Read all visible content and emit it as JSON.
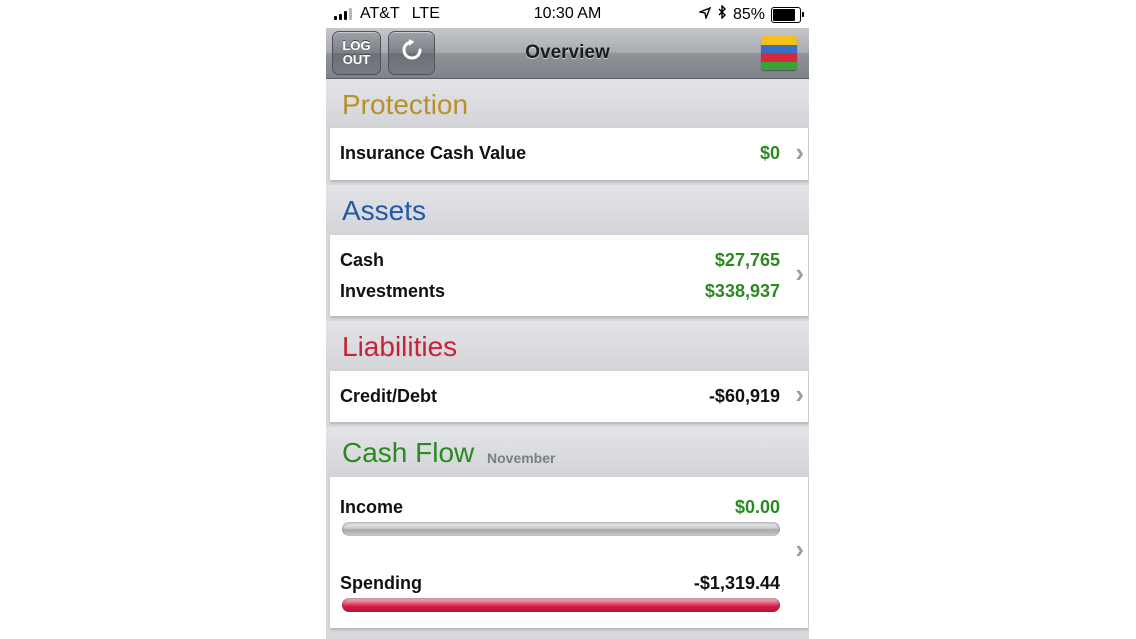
{
  "status_bar": {
    "carrier": "AT&T",
    "network": "LTE",
    "time": "10:30 AM",
    "battery_percent": "85%",
    "battery_level": 0.85
  },
  "nav": {
    "logout_label": "LOG\nOUT",
    "refresh_icon": "refresh-icon",
    "title": "Overview",
    "logo_icon": "app-logo-icon"
  },
  "colors": {
    "protection": "#b8902a",
    "assets": "#2358a6",
    "liabilities": "#c8213a",
    "cashflow": "#2a8a1f",
    "positive_value": "#2a8a1f",
    "spending_bar": "#d61c46"
  },
  "protection": {
    "title": "Protection",
    "rows": [
      {
        "label": "Insurance Cash Value",
        "value": "$0"
      }
    ]
  },
  "assets": {
    "title": "Assets",
    "rows": [
      {
        "label": "Cash",
        "value": "$27,765"
      },
      {
        "label": "Investments",
        "value": "$338,937"
      }
    ]
  },
  "liabilities": {
    "title": "Liabilities",
    "rows": [
      {
        "label": "Credit/Debt",
        "value": "-$60,919"
      }
    ]
  },
  "cashflow": {
    "title": "Cash Flow",
    "period": "November",
    "income": {
      "label": "Income",
      "value": "$0.00",
      "bar_fraction": 0.0
    },
    "spending": {
      "label": "Spending",
      "value": "-$1,319.44",
      "bar_fraction": 1.0
    }
  }
}
